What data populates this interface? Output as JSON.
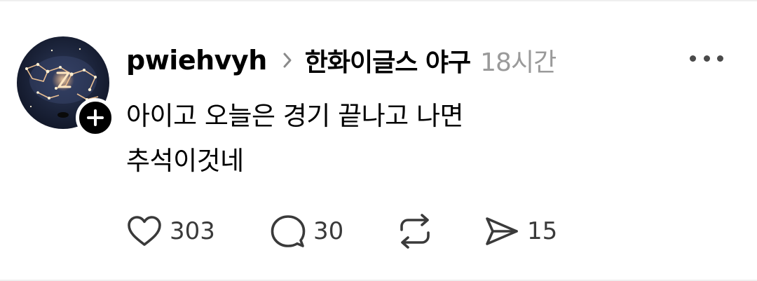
{
  "post": {
    "username": "pwiehvyh",
    "topic": "한화이글스 야구",
    "time": "18시간",
    "body_lines": [
      "아이고 오늘은 경기 끝나고 나면",
      "추석이것네"
    ],
    "stats": {
      "likes": "303",
      "replies": "30",
      "shares": "15"
    }
  },
  "icons": {
    "avatar": "constellation-avatar",
    "follow": "plus-icon",
    "chevron": "chevron-right-icon",
    "more": "more-horizontal-icon",
    "like": "heart-icon",
    "reply": "comment-bubble-icon",
    "repost": "repost-icon",
    "share": "send-icon"
  },
  "colors": {
    "text": "#000000",
    "muted": "#9a9a9a",
    "icon": "#3a3a3a",
    "badge": "#000000"
  }
}
